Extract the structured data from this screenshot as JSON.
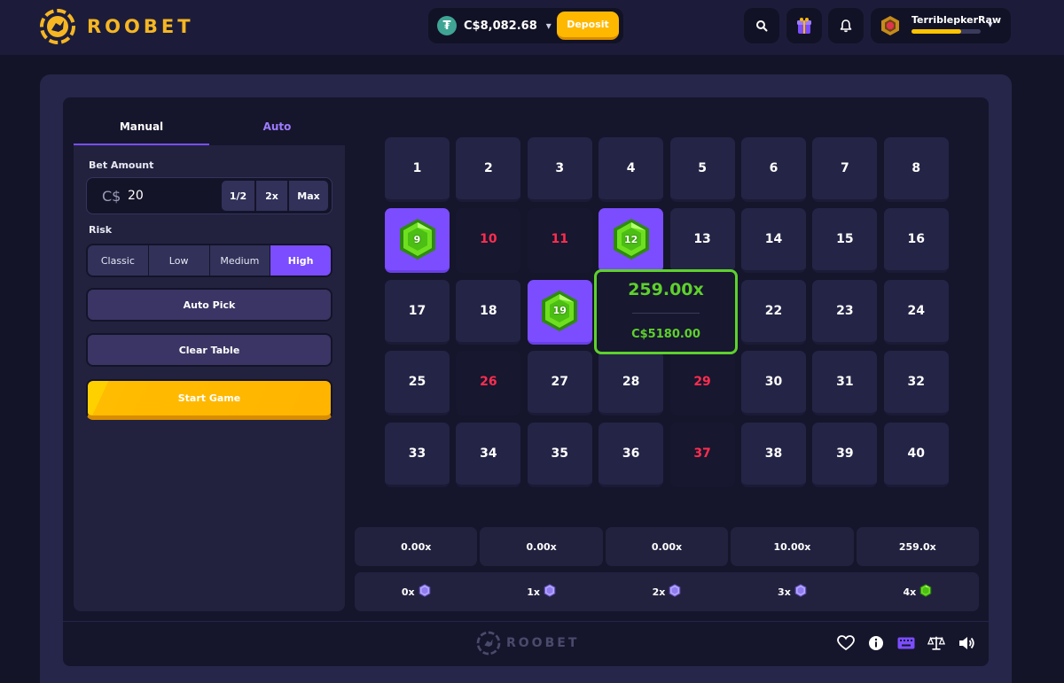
{
  "brand": {
    "name": "ROOBET"
  },
  "header": {
    "balance": "C$8,082.68",
    "currency_icon": "tether-coin-icon",
    "deposit_label": "Deposit",
    "username": "TerriblepkerRaw",
    "xp_progress": 0.72
  },
  "tabs": [
    {
      "label": "Manual",
      "active": true
    },
    {
      "label": "Auto",
      "active": false
    }
  ],
  "bet": {
    "label": "Bet Amount",
    "currency": "C$",
    "value": "20",
    "half_label": "1/2",
    "double_label": "2x",
    "max_label": "Max"
  },
  "risk": {
    "label": "Risk",
    "options": [
      "Classic",
      "Low",
      "Medium",
      "High"
    ],
    "selected": "High"
  },
  "actions": {
    "auto_pick": "Auto Pick",
    "clear_table": "Clear Table",
    "start_game": "Start Game"
  },
  "board": {
    "tiles": [
      {
        "n": "1",
        "s": "normal"
      },
      {
        "n": "2",
        "s": "normal"
      },
      {
        "n": "3",
        "s": "normal"
      },
      {
        "n": "4",
        "s": "normal"
      },
      {
        "n": "5",
        "s": "normal"
      },
      {
        "n": "6",
        "s": "normal"
      },
      {
        "n": "7",
        "s": "normal"
      },
      {
        "n": "8",
        "s": "normal"
      },
      {
        "n": "9",
        "s": "hit"
      },
      {
        "n": "10",
        "s": "miss"
      },
      {
        "n": "11",
        "s": "miss"
      },
      {
        "n": "12",
        "s": "hit"
      },
      {
        "n": "13",
        "s": "normal"
      },
      {
        "n": "14",
        "s": "normal"
      },
      {
        "n": "15",
        "s": "normal"
      },
      {
        "n": "16",
        "s": "normal"
      },
      {
        "n": "17",
        "s": "normal"
      },
      {
        "n": "18",
        "s": "normal"
      },
      {
        "n": "19",
        "s": "hit"
      },
      {
        "n": "",
        "s": "blank"
      },
      {
        "n": "",
        "s": "blank"
      },
      {
        "n": "22",
        "s": "normal"
      },
      {
        "n": "23",
        "s": "normal"
      },
      {
        "n": "24",
        "s": "normal"
      },
      {
        "n": "25",
        "s": "normal"
      },
      {
        "n": "26",
        "s": "miss"
      },
      {
        "n": "27",
        "s": "normal"
      },
      {
        "n": "28",
        "s": "normal"
      },
      {
        "n": "29",
        "s": "miss"
      },
      {
        "n": "30",
        "s": "normal"
      },
      {
        "n": "31",
        "s": "normal"
      },
      {
        "n": "32",
        "s": "normal"
      },
      {
        "n": "33",
        "s": "normal"
      },
      {
        "n": "34",
        "s": "normal"
      },
      {
        "n": "35",
        "s": "normal"
      },
      {
        "n": "36",
        "s": "normal"
      },
      {
        "n": "37",
        "s": "miss"
      },
      {
        "n": "38",
        "s": "normal"
      },
      {
        "n": "39",
        "s": "normal"
      },
      {
        "n": "40",
        "s": "normal"
      }
    ],
    "win_popup": {
      "multiplier": "259.00x",
      "amount": "C$5180.00"
    }
  },
  "payout_table": {
    "multipliers": [
      "0.00x",
      "0.00x",
      "0.00x",
      "10.00x",
      "259.0x"
    ],
    "hits": [
      {
        "label": "0x",
        "active": false
      },
      {
        "label": "1x",
        "active": false
      },
      {
        "label": "2x",
        "active": false
      },
      {
        "label": "3x",
        "active": false
      },
      {
        "label": "4x",
        "active": true
      }
    ]
  },
  "colors": {
    "accent": "#7b4dff",
    "gold": "#ffb800",
    "win_green": "#5ed12c",
    "miss_red": "#ff2d4f"
  },
  "footer_icons": [
    "heart-icon",
    "info-icon",
    "keyboard-icon",
    "balance-scale-icon",
    "volume-icon"
  ]
}
